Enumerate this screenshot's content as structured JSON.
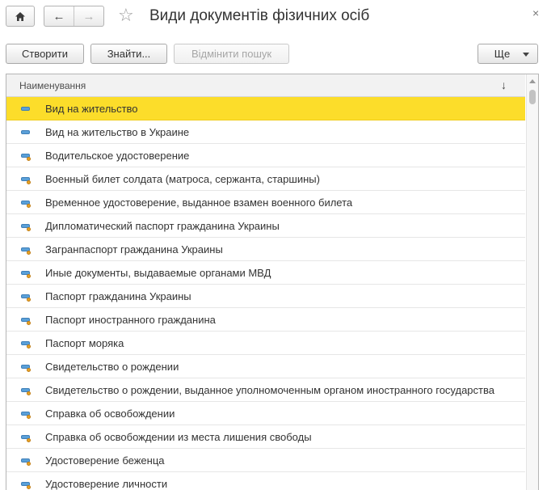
{
  "header": {
    "title": "Види документів фізичних осіб",
    "home_icon": "home-icon",
    "back_icon": "←",
    "forward_icon": "→",
    "star_icon": "☆",
    "close_icon": "×"
  },
  "toolbar": {
    "create_label": "Створити",
    "find_label": "Знайти...",
    "cancel_search_label": "Відмінити пошук",
    "more_label": "Ще"
  },
  "table": {
    "column_header": "Наименування",
    "sort_indicator": "↓",
    "rows": [
      {
        "label": "Вид на жительство",
        "selected": true
      },
      {
        "label": "Вид на жительство в Украине",
        "selected": false
      },
      {
        "label": "Водительское удостоверение",
        "selected": false
      },
      {
        "label": "Военный билет солдата (матроса, сержанта, старшины)",
        "selected": false
      },
      {
        "label": "Временное удостоверение, выданное взамен военного билета",
        "selected": false
      },
      {
        "label": "Дипломатический паспорт гражданина Украины",
        "selected": false
      },
      {
        "label": "Загранпаспорт гражданина Украины",
        "selected": false
      },
      {
        "label": "Иные документы, выдаваемые органами МВД",
        "selected": false
      },
      {
        "label": "Паспорт гражданина Украины",
        "selected": false
      },
      {
        "label": "Паспорт иностранного гражданина",
        "selected": false
      },
      {
        "label": "Паспорт моряка",
        "selected": false
      },
      {
        "label": "Свидетельство о рождении",
        "selected": false
      },
      {
        "label": "Свидетельство о рождении, выданное уполномоченным органом иностранного государства",
        "selected": false
      },
      {
        "label": "Справка об освобождении",
        "selected": false
      },
      {
        "label": "Справка об освобождении из места лишения свободы",
        "selected": false
      },
      {
        "label": "Удостоверение беженца",
        "selected": false
      },
      {
        "label": "Удостоверение личности",
        "selected": false
      }
    ]
  },
  "colors": {
    "selected_row": "#fcdd2a",
    "item_icon": "#5aa0d8"
  }
}
